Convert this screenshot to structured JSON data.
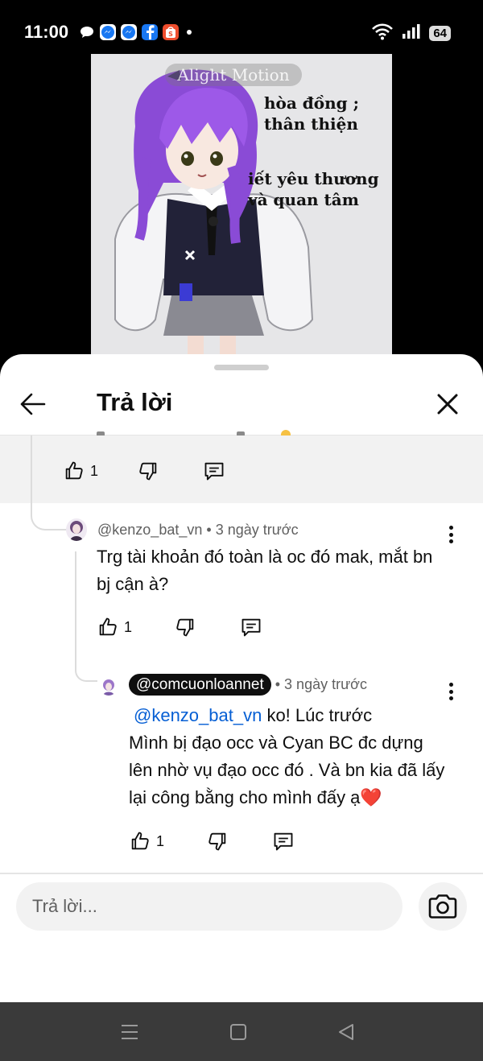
{
  "status_bar": {
    "time": "11:00",
    "battery": "64",
    "notification_icons": [
      {
        "name": "chat-bubble-icon",
        "glyph": "●",
        "color": "#ffffff"
      },
      {
        "name": "messenger-icon",
        "glyph": "m",
        "color": "#1877f2"
      },
      {
        "name": "messenger-icon-2",
        "glyph": "m",
        "color": "#1877f2"
      },
      {
        "name": "facebook-icon",
        "glyph": "f",
        "color": "#1877f2"
      },
      {
        "name": "shopee-icon",
        "glyph": "S",
        "color": "#ee4d2d"
      }
    ]
  },
  "video": {
    "watermark": "Alight Motion",
    "text_1": "hòa đồng ; thân thiện",
    "text_2": "iết yêu thương và quan tâm"
  },
  "sheet": {
    "title": "Trả lời"
  },
  "comments": [
    {
      "likes": "1"
    },
    {
      "handle": "@kenzo_bat_vn",
      "time": "3 ngày trước",
      "text": "Trg tài khoản đó toàn là oc đó mak, mắt bn bj cận à?",
      "likes": "1"
    },
    {
      "handle": "@comcuonloannet",
      "time": "3 ngày trước",
      "mention": "@kenzo_bat_vn",
      "text_line_1": " ko! Lúc trước",
      "text_rest": "Mình bị đạo occ và Cyan BC đc dựng lên nhờ vụ đạo occ đó . Và bn kia đã lấy lại công bằng cho mình đấy ạ",
      "emoji": "❤️",
      "likes": "1"
    }
  ],
  "reply_box": {
    "placeholder": "Trả lời..."
  },
  "colors": {
    "link": "#065fd4",
    "nav_bar": "#3a3a3a"
  }
}
